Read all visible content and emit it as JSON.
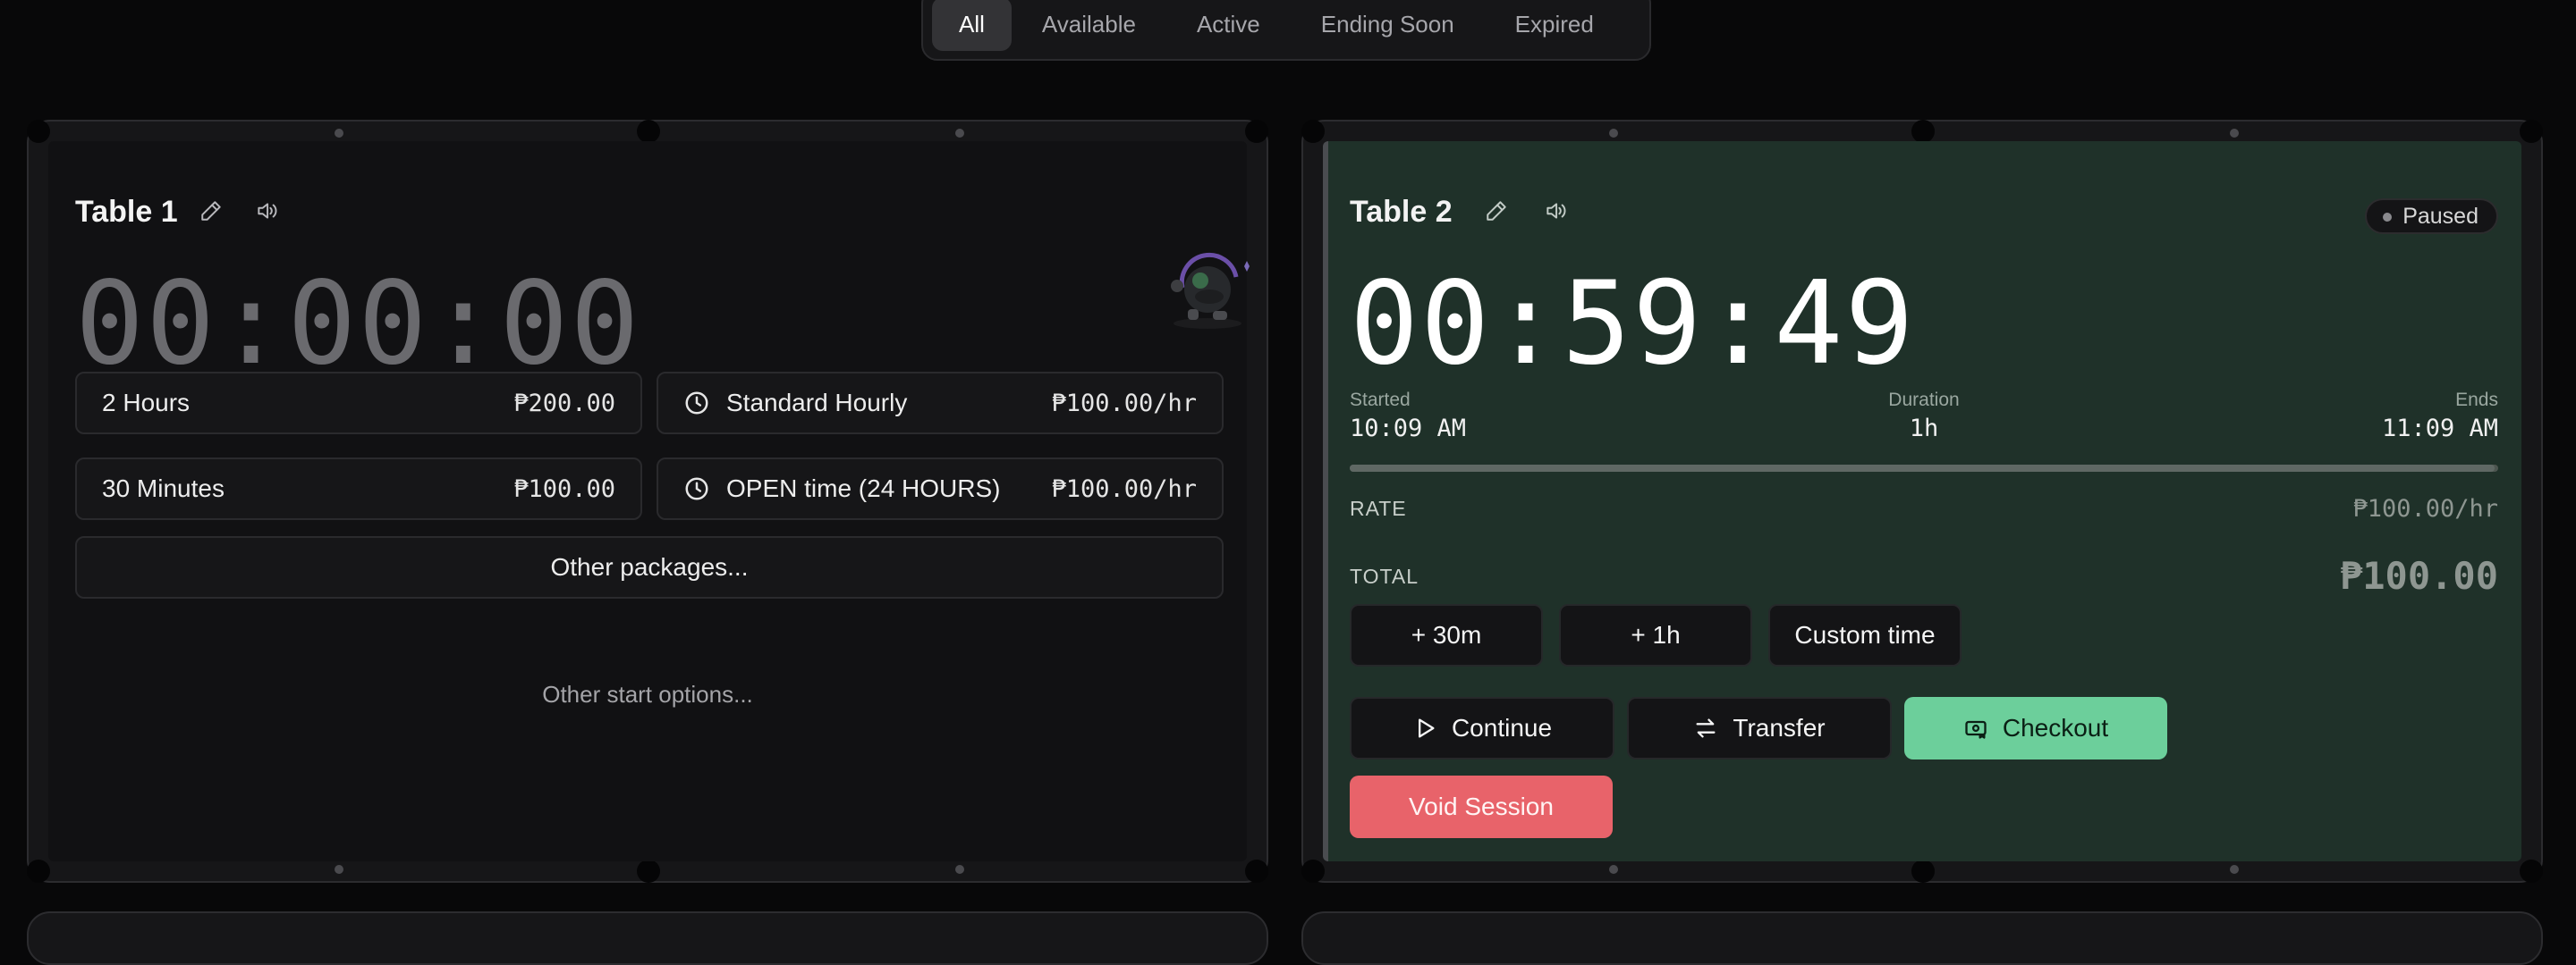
{
  "filters": {
    "tabs": [
      "All",
      "Available",
      "Active",
      "Ending Soon",
      "Expired"
    ],
    "active": "All"
  },
  "tables": [
    {
      "title": "Table 1",
      "timer": "00:00:00",
      "packages": [
        {
          "label": "2 Hours",
          "price": "₱200.00",
          "icon": null
        },
        {
          "label": "Standard Hourly",
          "price": "₱100.00/hr",
          "icon": "clock-icon"
        },
        {
          "label": "30 Minutes",
          "price": "₱100.00",
          "icon": null
        },
        {
          "label": "OPEN time (24 HOURS)",
          "price": "₱100.00/hr",
          "icon": "clock-icon"
        }
      ],
      "other_packages": "Other packages...",
      "other_start": "Other start options..."
    },
    {
      "title": "Table 2",
      "status": "Paused",
      "timer": "00:59:49",
      "started_label": "Started",
      "started": "10:09 AM",
      "duration_label": "Duration",
      "duration": "1h",
      "ends_label": "Ends",
      "ends": "11:09 AM",
      "rate_label": "RATE",
      "rate": "₱100.00/hr",
      "total_label": "TOTAL",
      "total": "₱100.00",
      "add_buttons": [
        "+ 30m",
        "+ 1h",
        "Custom time"
      ],
      "continue": "Continue",
      "transfer": "Transfer",
      "checkout": "Checkout",
      "void": "Void Session"
    }
  ],
  "colors": {
    "background": "#080809",
    "felt_active": "#1f3129",
    "checkout_green": "#6ccf9b",
    "void_red": "#e8636a"
  }
}
